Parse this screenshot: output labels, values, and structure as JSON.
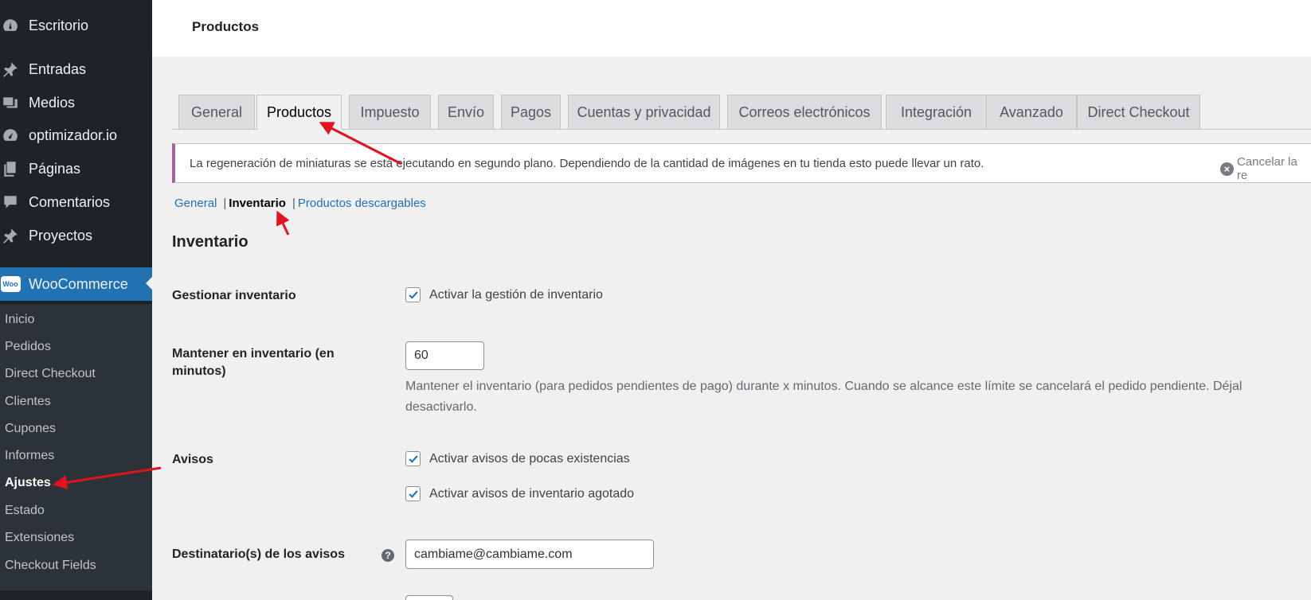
{
  "sidebar": {
    "items": [
      {
        "label": "Escritorio",
        "icon": "dashboard-icon"
      },
      {
        "label": "Entradas",
        "icon": "pin-icon"
      },
      {
        "label": "Medios",
        "icon": "media-icon"
      },
      {
        "label": "optimizador.io",
        "icon": "gauge-icon"
      },
      {
        "label": "Páginas",
        "icon": "pages-icon"
      },
      {
        "label": "Comentarios",
        "icon": "comment-icon"
      },
      {
        "label": "Proyectos",
        "icon": "pin-icon"
      },
      {
        "label": "WooCommerce",
        "icon": "woo-icon",
        "logo_text": "Woo"
      }
    ],
    "submenu": [
      "Inicio",
      "Pedidos",
      "Direct Checkout",
      "Clientes",
      "Cupones",
      "Informes",
      "Ajustes",
      "Estado",
      "Extensiones",
      "Checkout Fields"
    ]
  },
  "header": {
    "title": "Productos"
  },
  "tabs": [
    "General",
    "Productos",
    "Impuesto",
    "Envío",
    "Pagos",
    "Cuentas y privacidad",
    "Correos electrónicos",
    "Integración",
    "Avanzado",
    "Direct Checkout"
  ],
  "notice": {
    "message": "La regeneración de miniaturas se está ejecutando en segundo plano. Dependiendo de la cantidad de imágenes en tu tienda esto puede llevar un rato.",
    "cancel": "Cancelar la re"
  },
  "subnav": {
    "general": "General",
    "inventario": "Inventario",
    "descargables": "Productos descargables",
    "sep": "|"
  },
  "section_title": "Inventario",
  "fields": {
    "manage": {
      "label": "Gestionar inventario",
      "checkbox": "Activar la gestión de inventario"
    },
    "hold": {
      "label": "Mantener en inventario (en minutos)",
      "value": "60",
      "desc": "Mantener el inventario (para pedidos pendientes de pago) durante x minutos. Cuando se alcance este límite se cancelará el pedido pendiente. Déjal desactivarlo."
    },
    "notices": {
      "label": "Avisos",
      "low": "Activar avisos de pocas existencias",
      "out": "Activar avisos de inventario agotado"
    },
    "recipient": {
      "label": "Destinatario(s) de los avisos",
      "value": "cambiame@cambiame.com",
      "help": "?"
    }
  },
  "colors": {
    "sidebar": "#1d2327",
    "submenu": "#2c3338",
    "accent": "#2271b1",
    "arrow": "#e0141e"
  }
}
